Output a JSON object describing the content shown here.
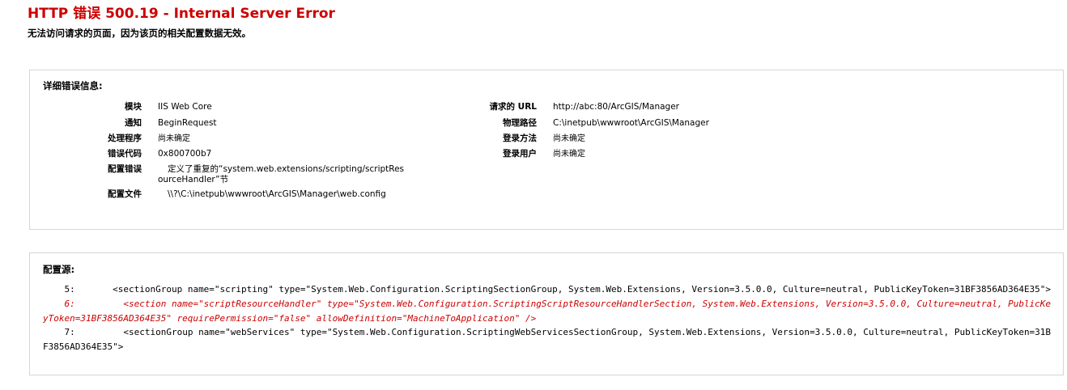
{
  "header": {
    "title": "HTTP 错误 500.19 - Internal Server Error",
    "subtitle": "无法访问请求的页面，因为该页的相关配置数据无效。"
  },
  "detail": {
    "heading": "详细错误信息:",
    "left_fields": [
      {
        "label": "模块",
        "value": "IIS Web Core"
      },
      {
        "label": "通知",
        "value": "BeginRequest"
      },
      {
        "label": "处理程序",
        "value": "尚未确定"
      },
      {
        "label": "错误代码",
        "value": "0x800700b7"
      },
      {
        "label": "配置错误",
        "value": "定义了重复的“system.web.extensions/scripting/scriptResourceHandler”节"
      },
      {
        "label": "配置文件",
        "value": "\\\\?\\C:\\inetpub\\wwwroot\\ArcGIS\\Manager\\web.config"
      }
    ],
    "right_fields": [
      {
        "label": "请求的 URL",
        "value": "http://abc:80/ArcGIS/Manager"
      },
      {
        "label": "物理路径",
        "value": "C:\\inetpub\\wwwroot\\ArcGIS\\Manager"
      },
      {
        "label": "登录方法",
        "value": "尚未确定"
      },
      {
        "label": "登录用户",
        "value": "尚未确定"
      }
    ]
  },
  "source": {
    "heading": "配置源:",
    "lines": [
      {
        "text": "    5:       <sectionGroup name=\"scripting\" type=\"System.Web.Configuration.ScriptingSectionGroup, System.Web.Extensions, Version=3.5.0.0, Culture=neutral, PublicKeyToken=31BF3856AD364E35\">",
        "highlight": false
      },
      {
        "text": "    6:         <section name=\"scriptResourceHandler\" type=\"System.Web.Configuration.ScriptingScriptResourceHandlerSection, System.Web.Extensions, Version=3.5.0.0, Culture=neutral, PublicKeyToken=31BF3856AD364E35\" requirePermission=\"false\" allowDefinition=\"MachineToApplication\" />",
        "highlight": true
      },
      {
        "text": "    7:         <sectionGroup name=\"webServices\" type=\"System.Web.Configuration.ScriptingWebServicesSectionGroup, System.Web.Extensions, Version=3.5.0.0, Culture=neutral, PublicKeyToken=31BF3856AD364E35\">",
        "highlight": false
      }
    ]
  },
  "colors": {
    "title": "#cc0000",
    "highlight": "#cc0000",
    "border": "#d6d6d6"
  }
}
